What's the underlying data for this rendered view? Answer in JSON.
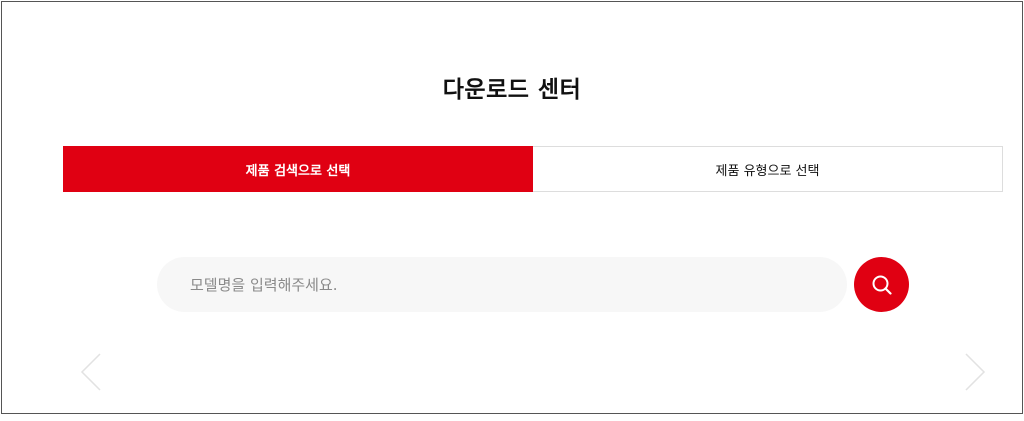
{
  "page": {
    "title": "다운로드 센터"
  },
  "tabs": [
    {
      "label": "제품 검색으로 선택",
      "active": true
    },
    {
      "label": "제품 유형으로 선택",
      "active": false
    }
  ],
  "search": {
    "placeholder": "모델명을 입력해주세요.",
    "value": "",
    "button_icon": "search-icon"
  },
  "carousel": {
    "prev_icon": "chevron-left-icon",
    "next_icon": "chevron-right-icon"
  },
  "colors": {
    "accent": "#e00012",
    "input_bg": "#f7f7f7",
    "text": "#111111",
    "placeholder": "#8a8a8a"
  }
}
